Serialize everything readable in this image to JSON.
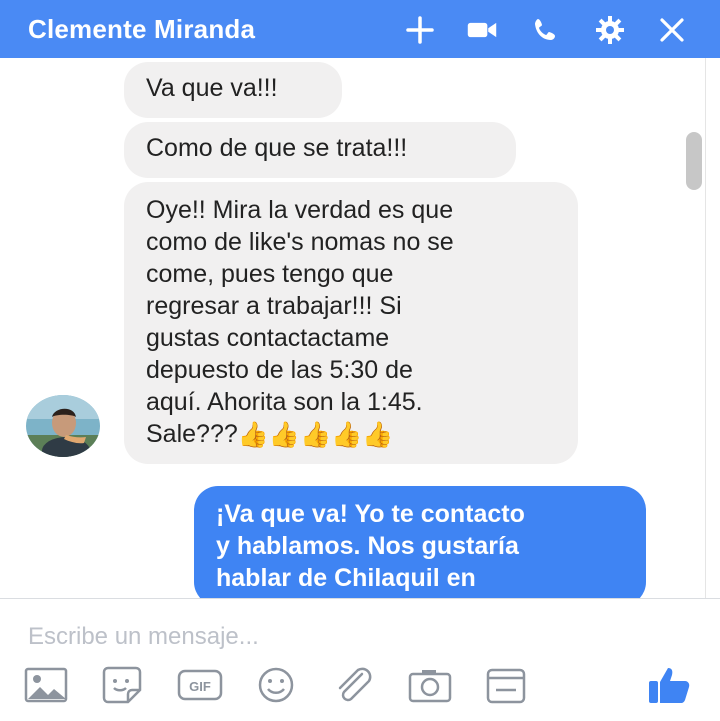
{
  "header": {
    "title": "Clemente Miranda",
    "icons": [
      "plus-icon",
      "video-camera-icon",
      "phone-icon",
      "gear-icon",
      "close-icon"
    ],
    "color": "#4a8af4"
  },
  "messages": [
    {
      "direction": "in",
      "text": "Va que va!!!"
    },
    {
      "direction": "in",
      "text": "Como de que se trata!!!"
    },
    {
      "direction": "in",
      "lines": [
        "Oye!! Mira la verdad es que",
        "como de like's nomas no se",
        "come, pues tengo que",
        "regresar a trabajar!!! Si",
        "gustas contactactame",
        "depuesto de las 5:30 de",
        "aquí. Ahorita son la 1:45.",
        "Sale???"
      ],
      "emoji": "👍👍👍👍👍"
    },
    {
      "direction": "out",
      "lines": [
        "¡Va que va! Yo te contacto",
        "y hablamos. Nos gustaría",
        "hablar de Chilaquil en"
      ]
    }
  ],
  "composer": {
    "placeholder": "Escribe un mensaje...",
    "tools": [
      "image-icon",
      "sticker-icon",
      "gif-icon",
      "emoji-icon",
      "paperclip-icon",
      "camera-icon",
      "calendar-icon"
    ],
    "gif_label": "GIF",
    "send_icon": "thumbs-up-icon"
  },
  "colors": {
    "incoming": "#f1f0f0",
    "outgoing": "#3f84f3"
  }
}
